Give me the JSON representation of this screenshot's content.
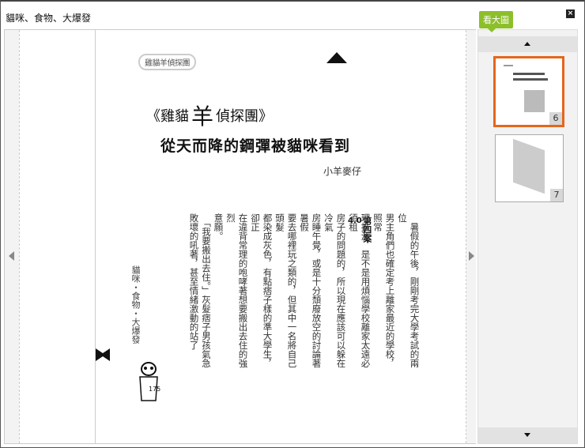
{
  "window": {
    "title": "貓咪、食物、大爆發",
    "close_icon": "close-icon"
  },
  "tooltip": {
    "label": "看大圖"
  },
  "page": {
    "running_head": "雞貓羊偵探團",
    "book_title_prefix": "《雞貓",
    "book_title_big": "羊",
    "book_title_suffix": "偵探團》",
    "subtitle": "從天而降的鋼彈被貓咪看到",
    "author": "小羊麥仔",
    "chapter_label": "第四案",
    "chapter_number": "4.0",
    "body_columns": [
      "　暑假的午後，剛剛考完大學考試的兩位",
      "男主角們也確定考上離家最近的學校，照常",
      "理推測，是不是用煩惱學校離家太遠必須租",
      "房子的問題的，所以現在應該可以躲在冷氣",
      "房睡午覺，或是十分頹廢放空的討論著暑假",
      "要去哪裡玩之類的，但其中一名將自己頭髮",
      "都染成灰色，有點痞子樣的準大學生，卻正",
      "在違背常理的咆哮著想要搬出去住的強烈",
      "意願。",
      "　「我要搬出去住。」灰髮痞子男孩氣急",
      "敗壞的吼著，甚至情緒激動的站了"
    ],
    "folio_title": "貓咪・食物・大爆發",
    "page_number": "175"
  },
  "thumbnails": [
    {
      "page": "6",
      "selected": true
    },
    {
      "page": "7",
      "selected": false
    }
  ],
  "colors": {
    "accent": "#e5661c",
    "tooltip": "#8cbf2a"
  }
}
